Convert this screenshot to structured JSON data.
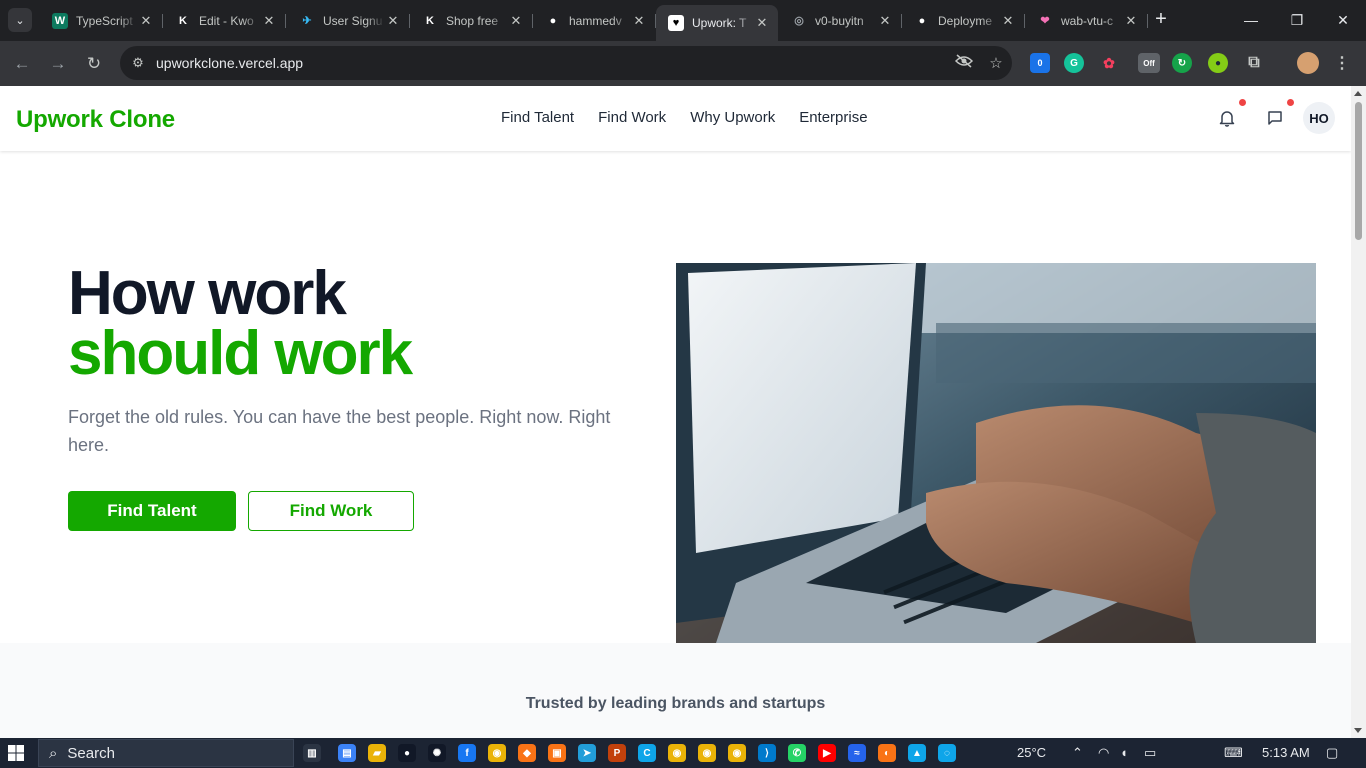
{
  "browser": {
    "tabs": [
      {
        "title": "TypeScript",
        "favicon": "W",
        "fav_color": "#0d7a5f",
        "fav_fg": "#ffffff"
      },
      {
        "title": "Edit - Kwo",
        "favicon": "K",
        "fav_color": "#202124",
        "fav_fg": "#ffffff"
      },
      {
        "title": "User Signu",
        "favicon": "✈",
        "fav_color": "#202124",
        "fav_fg": "#38bdf8"
      },
      {
        "title": "Shop free",
        "favicon": "K",
        "fav_color": "#202124",
        "fav_fg": "#ffffff"
      },
      {
        "title": "hammedv",
        "favicon": "●",
        "fav_color": "#202124",
        "fav_fg": "#ffffff"
      },
      {
        "title": "Upwork: T",
        "favicon": "♥",
        "fav_color": "#ffffff",
        "fav_fg": "#000000",
        "active": true
      },
      {
        "title": "v0-buyitn",
        "favicon": "◎",
        "fav_color": "#202124",
        "fav_fg": "#9aa0a6"
      },
      {
        "title": "Deployme",
        "favicon": "●",
        "fav_color": "#202124",
        "fav_fg": "#ffffff"
      },
      {
        "title": "wab-vtu-c",
        "favicon": "❤",
        "fav_color": "#202124",
        "fav_fg": "#f472b6"
      }
    ],
    "tab_close": "✕",
    "new_tab": "+",
    "window_controls": {
      "minimize": "—",
      "restore": "❐",
      "close": "✕"
    },
    "nav": {
      "back": "←",
      "forward": "→",
      "reload": "↻"
    },
    "url": "upworkclone.vercel.app",
    "extension_badge": "0",
    "extension_off_badge": "Off"
  },
  "site": {
    "brand": "Upwork Clone",
    "nav": [
      "Find Talent",
      "Find Work",
      "Why Upwork",
      "Enterprise"
    ],
    "avatar_initials": "HO",
    "hero": {
      "title_line1": "How work",
      "title_line2": "should work",
      "subtitle": "Forget the old rules. You can have the best people. Right now. Right here.",
      "primary_button": "Find Talent",
      "secondary_button": "Find Work"
    },
    "trusted_heading": "Trusted by leading brands and startups",
    "colors": {
      "brand_green": "#14a800",
      "heading": "#111827",
      "muted": "#6b7280"
    }
  },
  "taskbar": {
    "search_placeholder": "Search",
    "weather": "25°C",
    "time": "5:13 AM"
  }
}
